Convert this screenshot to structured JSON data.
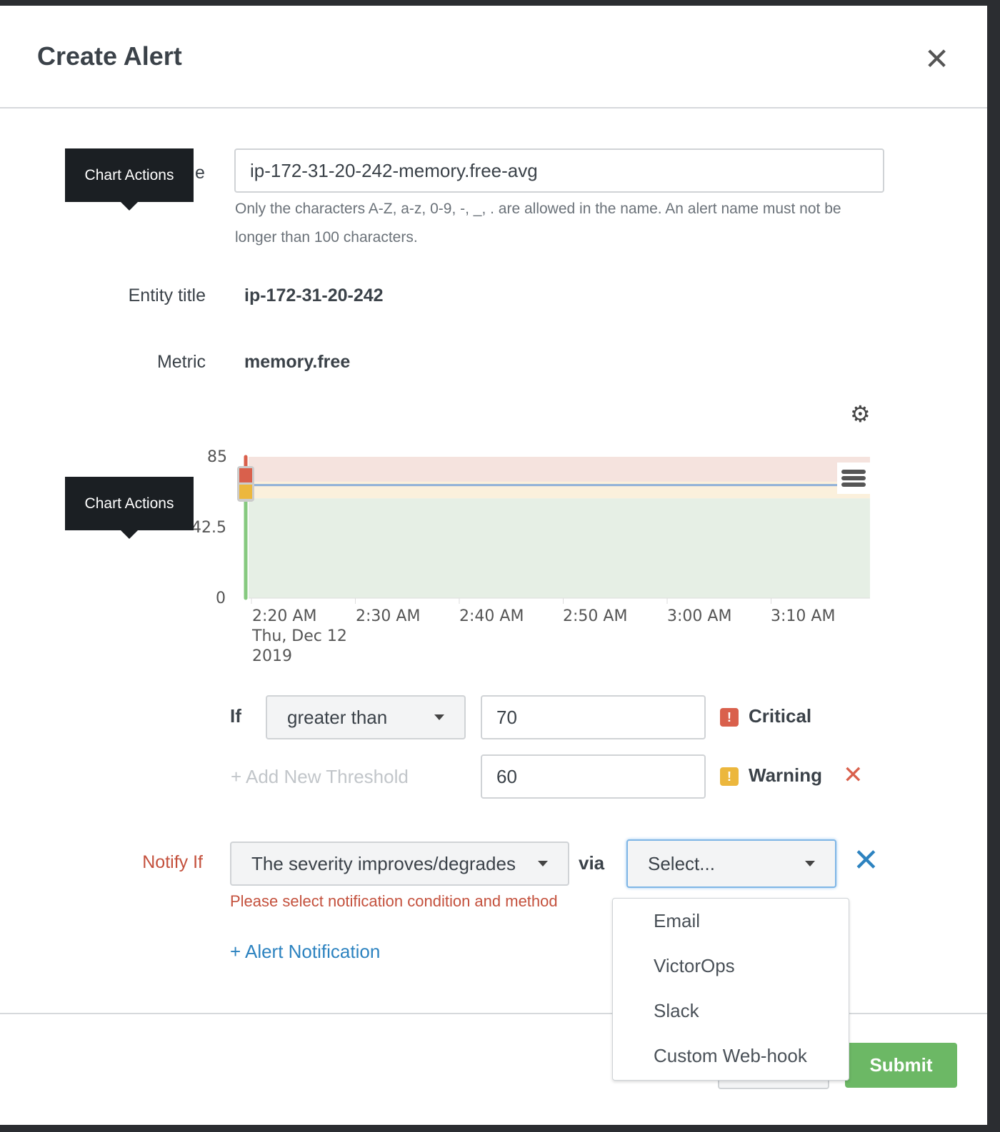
{
  "modal": {
    "title": "Create Alert",
    "close_icon": "close-icon"
  },
  "tooltips": [
    "Chart Actions",
    "Chart Actions"
  ],
  "name_label_fragment": "e",
  "name_input": {
    "value": "ip-172-31-20-242-memory.free-avg"
  },
  "name_hint": "Only the characters A-Z, a-z, 0-9, -, _, . are allowed in the name. An alert name must not be longer than 100 characters.",
  "entity": {
    "label": "Entity title",
    "value": "ip-172-31-20-242"
  },
  "metric": {
    "label": "Metric",
    "value": "memory.free"
  },
  "chart_data": {
    "type": "line",
    "y_ticks": [
      "85",
      "42.5",
      "0"
    ],
    "ylim": [
      0,
      85
    ],
    "x_ticks": [
      "2:20 AM",
      "2:30 AM",
      "2:40 AM",
      "2:50 AM",
      "3:00 AM",
      "3:10 AM"
    ],
    "x_tick_sublabel": [
      "Thu, Dec 12",
      "2019"
    ],
    "series": [
      {
        "values": [
          68,
          68,
          68,
          68,
          68,
          68,
          68
        ]
      }
    ],
    "bands": {
      "critical_above": 70,
      "warning_above": 60
    },
    "colors": {
      "line": "#8fb0d8",
      "critical": "#f5e3de",
      "warning": "#fbf0dc",
      "ok": "#e6efe5"
    }
  },
  "threshold": {
    "if_label": "If",
    "operator": "greater than",
    "critical_value": "70",
    "critical_label": "Critical",
    "warning_value": "60",
    "warning_label": "Warning",
    "add_label": "+ Add New Threshold"
  },
  "notify": {
    "label": "Notify If",
    "condition": "The severity improves/degrades",
    "via": "via",
    "method_placeholder": "Select...",
    "error": "Please select notification condition and method",
    "add_label": "+ Alert Notification",
    "options": [
      "Email",
      "VictorOps",
      "Slack",
      "Custom Web-hook"
    ]
  },
  "footer": {
    "submit": "Submit"
  },
  "colors": {
    "critical": "#d9604c",
    "warning": "#ecb73d",
    "accent": "#2d83c0",
    "submit": "#6cb865"
  }
}
